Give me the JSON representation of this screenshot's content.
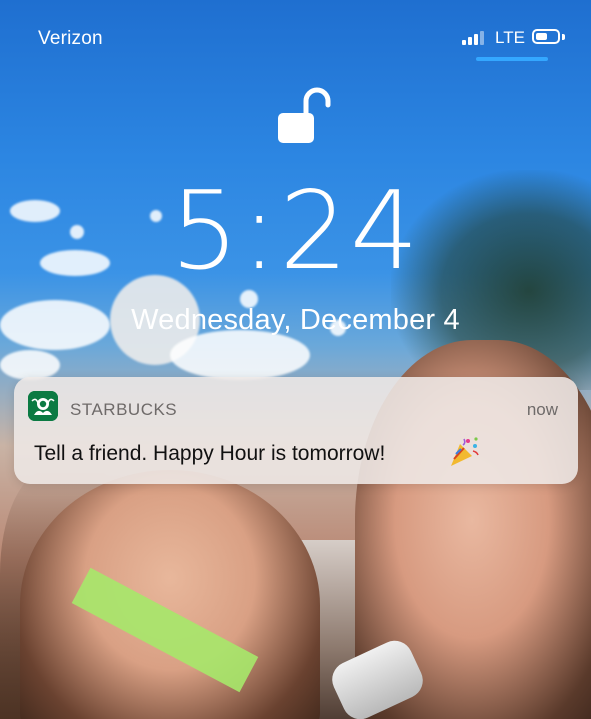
{
  "status_bar": {
    "carrier": "Verizon",
    "network": "LTE",
    "battery_level": 0.55,
    "signal_bars_filled": 3,
    "signal_bars_total": 4,
    "icons": [
      "signal-bars-icon",
      "battery-icon"
    ],
    "accent_color": "#34a7ff"
  },
  "lock_screen": {
    "lock_icon": "unlocked-padlock-icon",
    "time": "5:24",
    "date": "Wednesday, December 4"
  },
  "notification": {
    "app_icon": "starbucks-siren-logo-icon",
    "app_name": "STARBUCKS",
    "timestamp": "now",
    "message": "Tell a friend. Happy Hour is tomorrow!",
    "emoji_icon": "party-popper-icon",
    "brand_color": "#0b7a43"
  }
}
